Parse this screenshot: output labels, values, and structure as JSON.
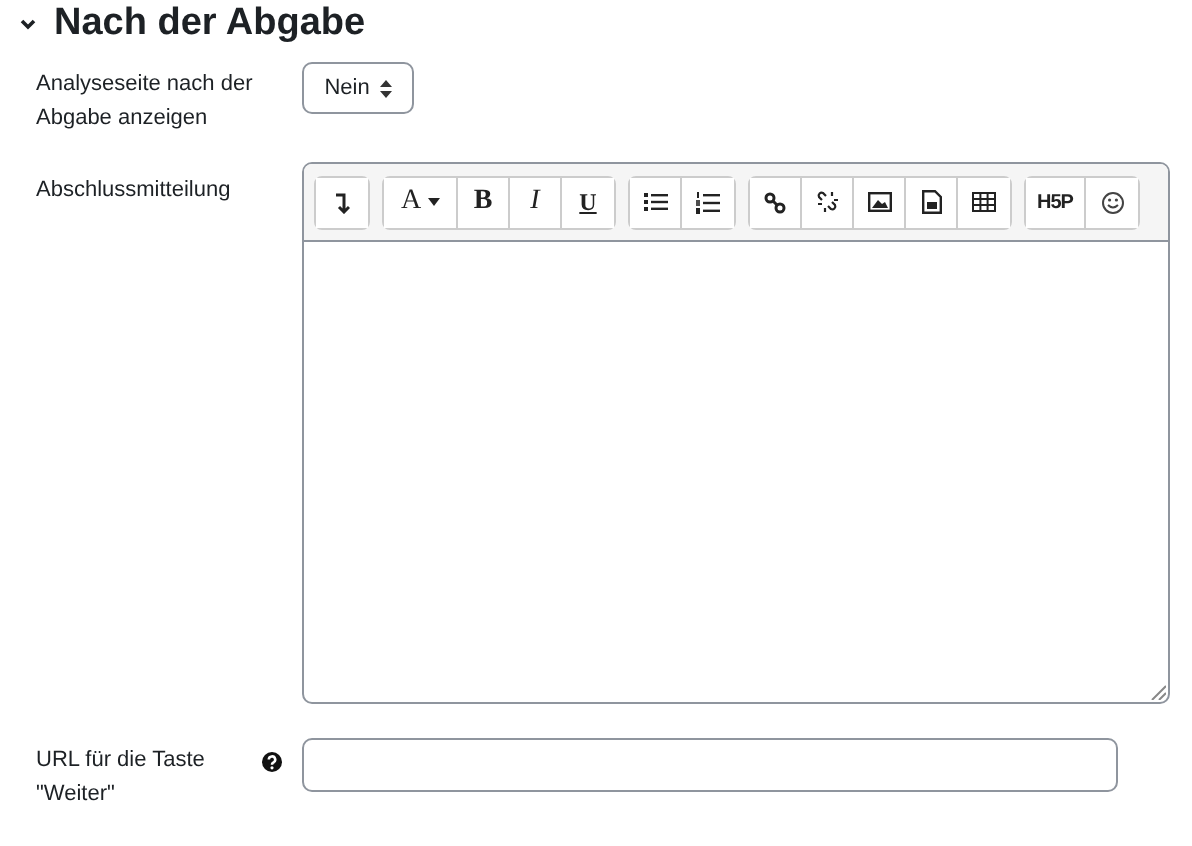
{
  "section": {
    "title": "Nach der Abgabe",
    "expanded": true
  },
  "show_analysis": {
    "label": "Analyseseite nach der Abgabe anzeigen",
    "value": "Nein"
  },
  "completion_message": {
    "label": "Abschlussmitteilung",
    "toolbar": [
      {
        "buttons": [
          {
            "kind": "icon"
          }
        ]
      },
      {
        "buttons": [
          {
            "kind": "font",
            "label": "A"
          },
          {
            "kind": "bold",
            "label": "B"
          },
          {
            "kind": "italic",
            "label": "I"
          },
          {
            "kind": "underline",
            "label": "U"
          }
        ]
      },
      {
        "buttons": [
          {
            "kind": "icon"
          },
          {
            "kind": "icon"
          }
        ]
      },
      {
        "buttons": [
          {
            "kind": "icon"
          },
          {
            "kind": "icon"
          },
          {
            "kind": "icon"
          },
          {
            "kind": "icon"
          },
          {
            "kind": "icon"
          }
        ]
      },
      {
        "buttons": [
          {
            "kind": "logo",
            "label": "H5P"
          },
          {
            "kind": "icon"
          }
        ]
      }
    ]
  },
  "continue_url": {
    "label": "URL für die Taste \"Weiter\"",
    "has_help": true
  }
}
